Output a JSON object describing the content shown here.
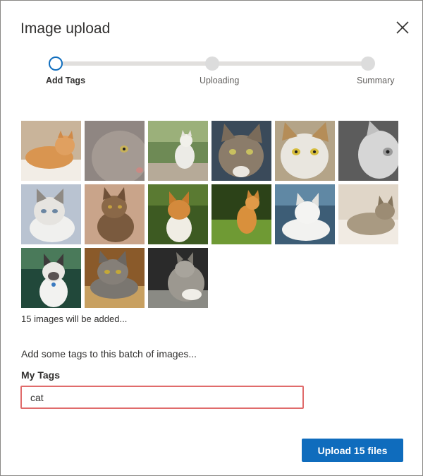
{
  "dialog": {
    "title": "Image upload",
    "close_icon": "close-icon"
  },
  "stepper": {
    "steps": [
      {
        "label": "Add Tags",
        "state": "active"
      },
      {
        "label": "Uploading",
        "state": "pending"
      },
      {
        "label": "Summary",
        "state": "pending"
      }
    ],
    "active_color": "#106ebe"
  },
  "images": {
    "count": 15,
    "count_text": "15 images will be added...",
    "thumbnails": [
      "cat-photo",
      "cat-photo",
      "cat-photo",
      "cat-photo",
      "cat-photo",
      "cat-photo",
      "cat-photo",
      "cat-photo",
      "cat-photo",
      "cat-photo",
      "cat-photo",
      "cat-photo",
      "cat-photo",
      "cat-photo",
      "cat-photo"
    ]
  },
  "tags": {
    "prompt": "Add some tags to this batch of images...",
    "label": "My Tags",
    "value": "cat",
    "highlight_color": "#e06b6b"
  },
  "actions": {
    "upload_label": "Upload 15 files",
    "primary_color": "#0f6cbd"
  }
}
